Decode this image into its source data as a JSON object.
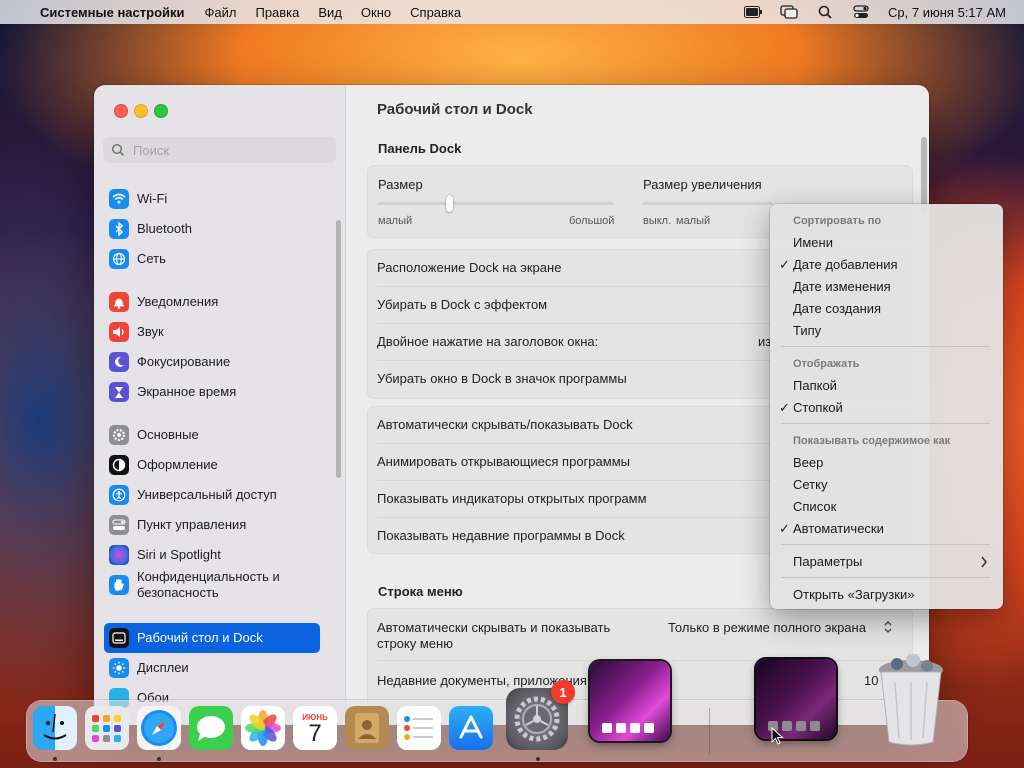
{
  "menubar": {
    "app_name": "Системные настройки",
    "menus": [
      "Файл",
      "Правка",
      "Вид",
      "Окно",
      "Справка"
    ],
    "clock": "Ср, 7 июня  5:17 AM"
  },
  "window": {
    "search_placeholder": "Поиск",
    "title": "Рабочий стол и Dock"
  },
  "sidebar": {
    "items": [
      {
        "label": "Wi-Fi",
        "color": "#1a8cf0",
        "icon": "wifi-icon"
      },
      {
        "label": "Bluetooth",
        "color": "#1a8cf0",
        "icon": "bluetooth-icon"
      },
      {
        "label": "Сеть",
        "color": "#1a8cf0",
        "icon": "globe-icon"
      },
      {
        "label": "Уведомления",
        "color": "#f0443a",
        "icon": "bell-icon"
      },
      {
        "label": "Звук",
        "color": "#f0443a",
        "icon": "speaker-icon"
      },
      {
        "label": "Фокусирование",
        "color": "#5b52d6",
        "icon": "moon-icon"
      },
      {
        "label": "Экранное время",
        "color": "#5b52d6",
        "icon": "hourglass-icon"
      },
      {
        "label": "Основные",
        "color": "#8e8e93",
        "icon": "gear-icon"
      },
      {
        "label": "Оформление",
        "color": "#111111",
        "icon": "appearance-icon"
      },
      {
        "label": "Универсальный доступ",
        "color": "#1a8cf0",
        "icon": "accessibility-icon"
      },
      {
        "label": "Пункт управления",
        "color": "#8e8e93",
        "icon": "control-center-icon"
      },
      {
        "label": "Siri и Spotlight",
        "color": "#333333",
        "icon": "siri-icon"
      },
      {
        "label": "Конфиденциальность и безопасность",
        "color": "#1a8cf0",
        "icon": "hand-icon"
      },
      {
        "label": "Рабочий стол и Dock",
        "color": "#111111",
        "icon": "dock-icon"
      },
      {
        "label": "Дисплеи",
        "color": "#1a8cf0",
        "icon": "sun-icon"
      },
      {
        "label": "Обои",
        "color": "#2ab0e8",
        "icon": "wallpaper-icon"
      }
    ]
  },
  "content": {
    "dock_section": "Панель Dock",
    "size_label": "Размер",
    "size_min": "малый",
    "size_max": "большой",
    "size_value": 0.3,
    "mag_label": "Размер увеличения",
    "mag_off": "выкл.",
    "mag_min": "малый",
    "rows_group1": [
      "Расположение Dock на экране",
      "Убирать в Dock с эффектом",
      "Двойное нажатие на заголовок окна:",
      "Убирать окно в Dock в значок программы"
    ],
    "partial_value_row3": "из",
    "rows_group2": [
      "Автоматически скрывать/показывать Dock",
      "Анимировать открывающиеся программы",
      "Показывать индикаторы открытых программ",
      "Показывать недавние программы в Dock"
    ],
    "menubar_section": "Строка меню",
    "autohide_menubar_label": "Автоматически скрывать и показывать строку меню",
    "autohide_menubar_value": "Только в режиме полного экрана",
    "recent_docs_label": "Недавние документы, приложения",
    "recent_docs_value": "10"
  },
  "context_menu": {
    "sort_header": "Сортировать по",
    "sort_items": [
      {
        "label": "Имени",
        "checked": false
      },
      {
        "label": "Дате добавления",
        "checked": true
      },
      {
        "label": "Дате изменения",
        "checked": false
      },
      {
        "label": "Дате создания",
        "checked": false
      },
      {
        "label": "Типу",
        "checked": false
      }
    ],
    "display_header": "Отображать",
    "display_items": [
      {
        "label": "Папкой",
        "checked": false
      },
      {
        "label": "Стопкой",
        "checked": true
      }
    ],
    "view_header": "Показывать содержимое как",
    "view_items": [
      {
        "label": "Веер",
        "checked": false
      },
      {
        "label": "Сетку",
        "checked": false
      },
      {
        "label": "Список",
        "checked": false
      },
      {
        "label": "Автоматически",
        "checked": true
      }
    ],
    "options": "Параметры",
    "open_downloads": "Открыть «Загрузки»",
    "check_mark": "✓"
  },
  "dock": {
    "apps": [
      "Finder",
      "Launchpad",
      "Safari",
      "Сообщения",
      "Фото",
      "Календарь",
      "Контакты",
      "Напоминания",
      "App Store",
      "Системные настройки"
    ],
    "calendar_month": "ИЮНЬ",
    "calendar_day": "7",
    "settings_badge": "1"
  }
}
